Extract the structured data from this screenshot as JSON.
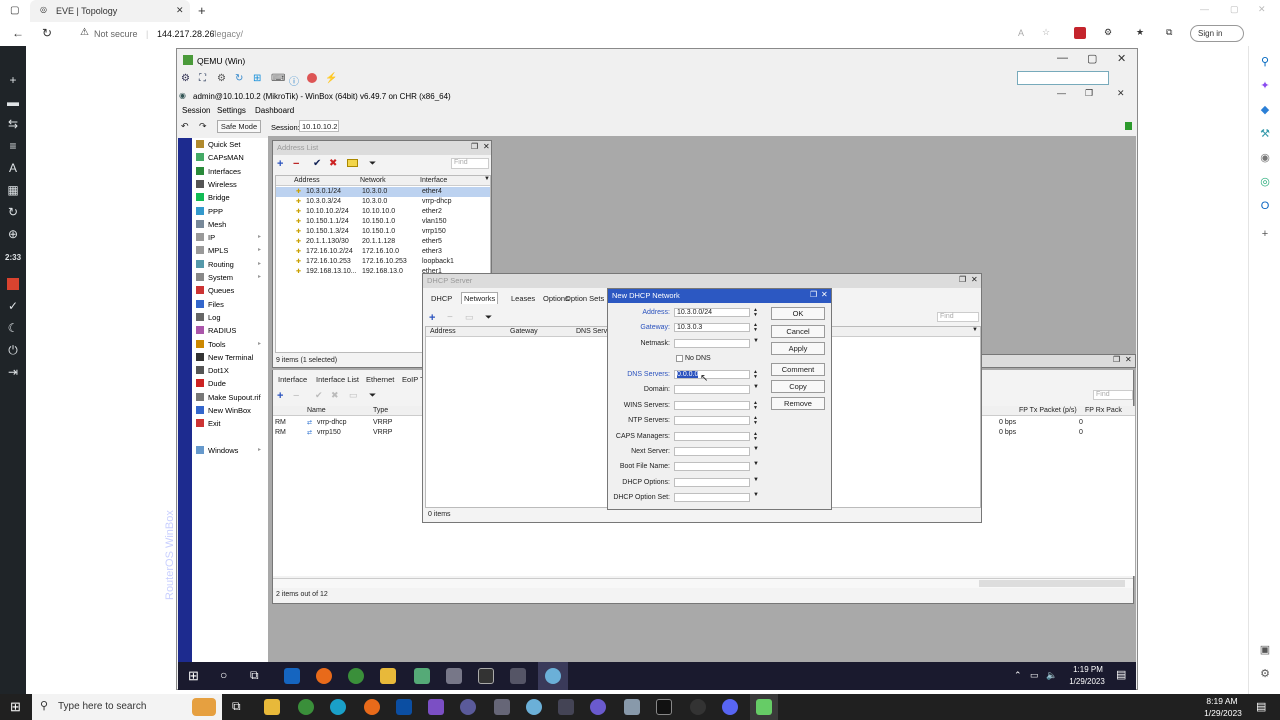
{
  "browser": {
    "tab_title": "EVE | Topology",
    "new_tab": "+",
    "not_secure": "Not secure",
    "url_host": "144.217.28.26",
    "url_path": "/legacy/",
    "sign_in": "Sign in"
  },
  "sidebar_left": {
    "clock": "2:33"
  },
  "qemu": {
    "title": "QEMU (Win)",
    "winbox_title": "admin@10.10.10.2 (MikroTik) - WinBox (64bit) v6.49.7 on CHR (x86_64)",
    "menu": [
      "Session",
      "Settings",
      "Dashboard"
    ],
    "safe_mode": "Safe Mode",
    "session_label": "Session:",
    "session_value": "10.10.10.2",
    "vertical_label": "RouterOS WinBox"
  },
  "nav": [
    {
      "label": "Quick Set",
      "color": "#b08a2e"
    },
    {
      "label": "CAPsMAN",
      "color": "#4a6"
    },
    {
      "label": "Interfaces",
      "color": "#2a8a3a"
    },
    {
      "label": "Wireless",
      "color": "#555"
    },
    {
      "label": "Bridge",
      "color": "#1b5"
    },
    {
      "label": "PPP",
      "color": "#39c"
    },
    {
      "label": "Mesh",
      "color": "#789"
    },
    {
      "label": "IP",
      "color": "#999"
    },
    {
      "label": "MPLS",
      "color": "#999"
    },
    {
      "label": "Routing",
      "color": "#59a"
    },
    {
      "label": "System",
      "color": "#888"
    },
    {
      "label": "Queues",
      "color": "#c33"
    },
    {
      "label": "Files",
      "color": "#36c"
    },
    {
      "label": "Log",
      "color": "#666"
    },
    {
      "label": "RADIUS",
      "color": "#a5a"
    },
    {
      "label": "Tools",
      "color": "#c80"
    },
    {
      "label": "New Terminal",
      "color": "#333"
    },
    {
      "label": "Dot1X",
      "color": "#555"
    },
    {
      "label": "Dude",
      "color": "#c22"
    },
    {
      "label": "Make Supout.rif",
      "color": "#777"
    },
    {
      "label": "New WinBox",
      "color": "#36c"
    },
    {
      "label": "Exit",
      "color": "#c33"
    },
    {
      "label": "Windows",
      "color": "#69c"
    }
  ],
  "address_list": {
    "title": "Address List",
    "find": "Find",
    "columns": [
      "Address",
      "Network",
      "Interface"
    ],
    "rows": [
      [
        "10.3.0.1/24",
        "10.3.0.0",
        "ether4"
      ],
      [
        "10.3.0.3/24",
        "10.3.0.0",
        "vrrp-dhcp"
      ],
      [
        "10.10.10.2/24",
        "10.10.10.0",
        "ether2"
      ],
      [
        "10.150.1.1/24",
        "10.150.1.0",
        "vlan150"
      ],
      [
        "10.150.1.3/24",
        "10.150.1.0",
        "vrrp150"
      ],
      [
        "20.1.1.130/30",
        "20.1.1.128",
        "ether5"
      ],
      [
        "172.16.10.2/24",
        "172.16.10.0",
        "ether3"
      ],
      [
        "172.16.10.253",
        "172.16.10.253",
        "loopback1"
      ],
      [
        "192.168.13.10...",
        "192.168.13.0",
        "ether1"
      ]
    ],
    "status": "9 items (1 selected)"
  },
  "interface_list": {
    "tabs": [
      "Interface",
      "Interface List",
      "Ethernet",
      "EoIP T"
    ],
    "columns": [
      "Name",
      "Type"
    ],
    "rows": [
      [
        "RM",
        "vrrp-dhcp",
        "VRRP"
      ],
      [
        "RM",
        "vrrp150",
        "VRRP"
      ]
    ],
    "right_columns": [
      "FP Tx Packet (p/s)",
      "FP Rx Pack"
    ],
    "right_rows": [
      [
        "0 bps",
        "0"
      ],
      [
        "0 bps",
        "0"
      ]
    ],
    "status": "2 items out of 12",
    "find": "Find"
  },
  "dhcp_server": {
    "title": "DHCP Server",
    "tabs": [
      "DHCP",
      "Networks",
      "Leases",
      "Options",
      "Option Sets"
    ],
    "columns": [
      "Address",
      "Gateway",
      "DNS Serv"
    ],
    "status": "0 items",
    "find": "Find"
  },
  "new_dhcp_network": {
    "title": "New DHCP Network",
    "fields": [
      {
        "label": "Address:",
        "value": "10.3.0.0/24",
        "blue": true
      },
      {
        "label": "Gateway:",
        "value": "10.3.0.3",
        "blue": true
      },
      {
        "label": "Netmask:",
        "value": "",
        "blue": false
      },
      {
        "label": "DNS Servers:",
        "value": "0.0.0.0",
        "blue": true
      },
      {
        "label": "Domain:",
        "value": "",
        "blue": false
      },
      {
        "label": "WINS Servers:",
        "value": "",
        "blue": false
      },
      {
        "label": "NTP Servers:",
        "value": "",
        "blue": false
      },
      {
        "label": "CAPS Managers:",
        "value": "",
        "blue": false
      },
      {
        "label": "Next Server:",
        "value": "",
        "blue": false
      },
      {
        "label": "Boot File Name:",
        "value": "",
        "blue": false
      },
      {
        "label": "DHCP Options:",
        "value": "",
        "blue": false
      },
      {
        "label": "DHCP Option Set:",
        "value": "",
        "blue": false
      }
    ],
    "no_dns": "No DNS",
    "buttons": [
      "OK",
      "Cancel",
      "Apply",
      "Comment",
      "Copy",
      "Remove"
    ]
  },
  "inner_taskbar": {
    "time": "1:19 PM",
    "date": "1/29/2023"
  },
  "outer_taskbar": {
    "search": "Type here to search",
    "time": "8:19 AM",
    "date": "1/29/2023"
  }
}
